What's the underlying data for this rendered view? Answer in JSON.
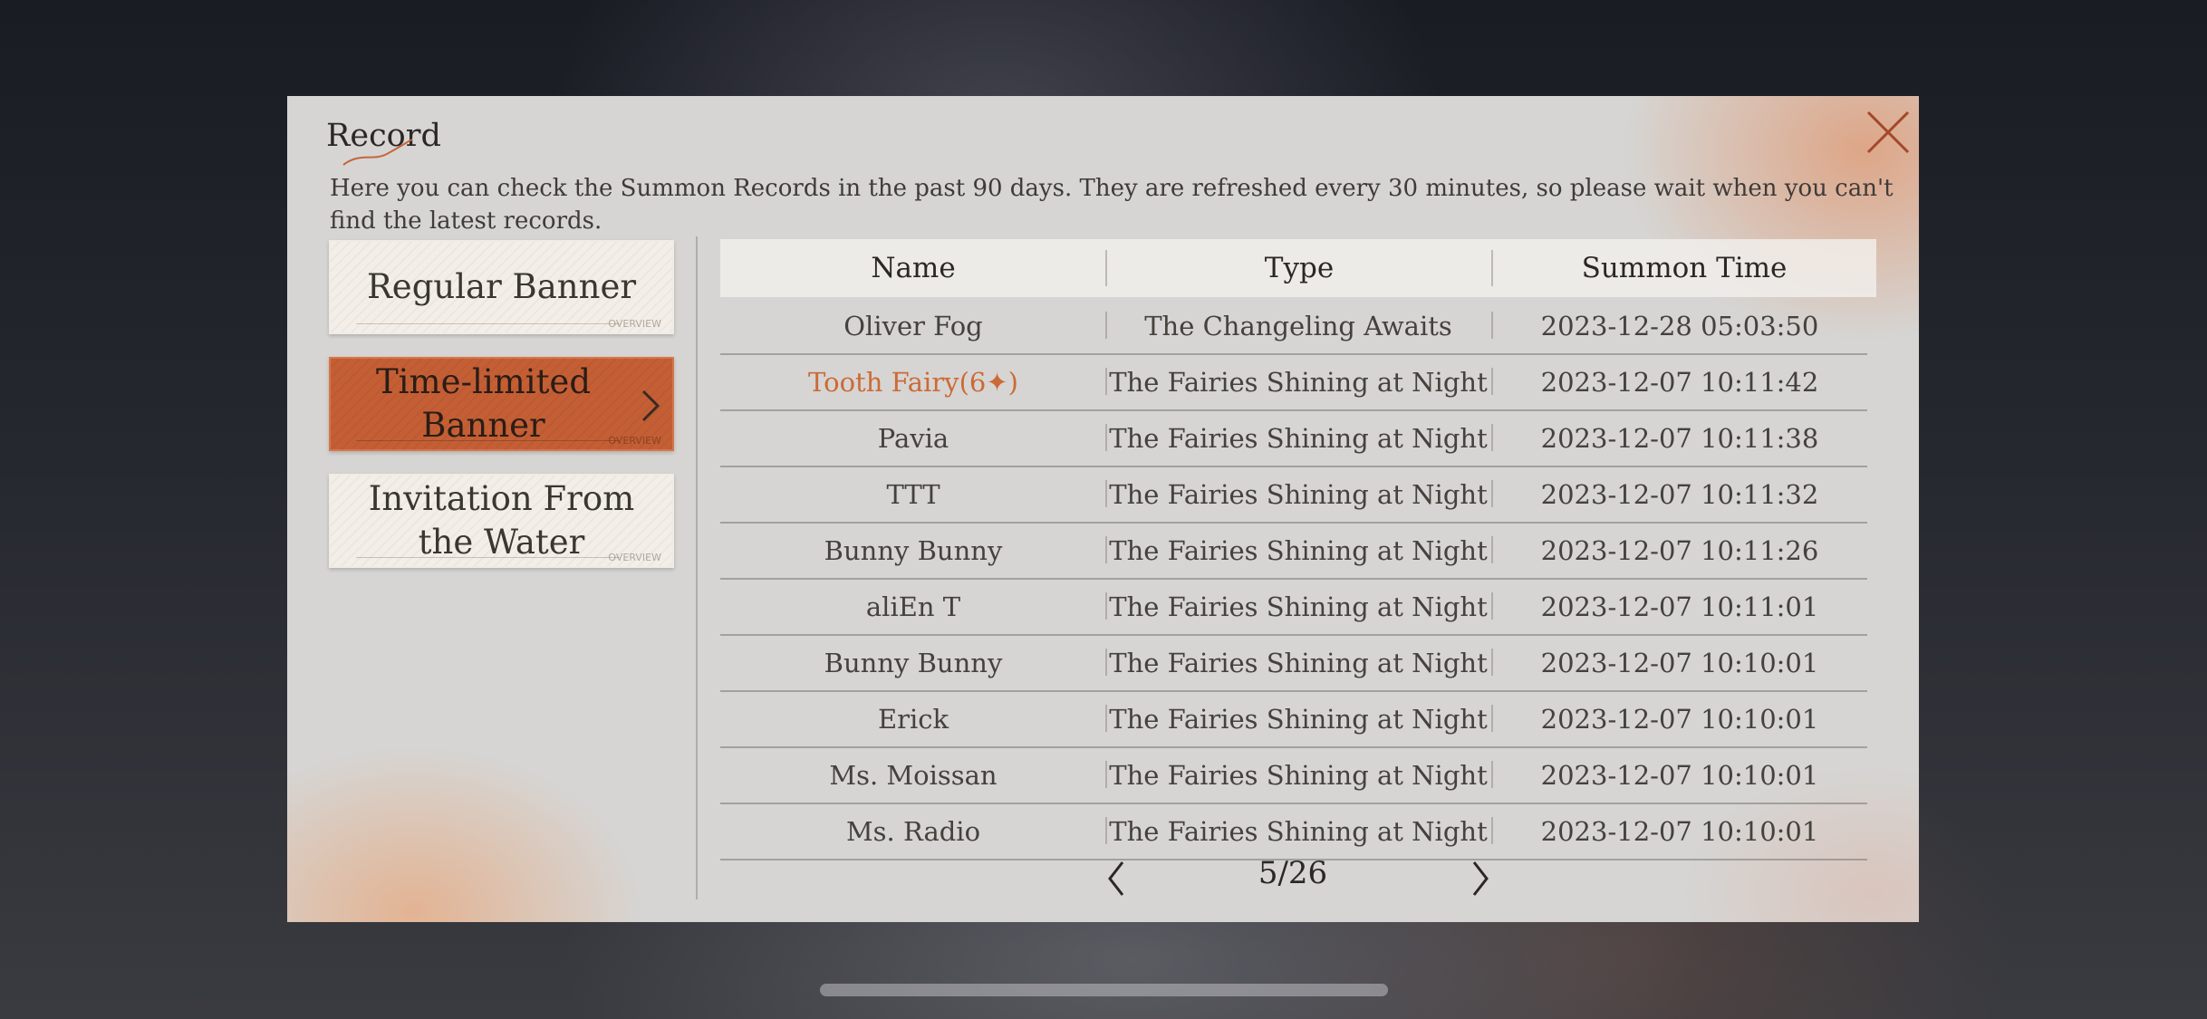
{
  "dialog": {
    "title": "Record",
    "description": "Here you can check the Summon Records in the past 90 days. They are refreshed every 30 minutes, so please wait when you can't find the latest records.",
    "accent_color": "#c45f35",
    "close_icon": "close-icon"
  },
  "banners": [
    {
      "label": "Regular Banner",
      "active": false
    },
    {
      "label": "Time-limited Banner",
      "active": true
    },
    {
      "label": "Invitation From the Water",
      "active": false
    }
  ],
  "table": {
    "headers": [
      "Name",
      "Type",
      "Summon Time"
    ],
    "rows": [
      {
        "name": "Oliver Fog",
        "type": "The Changeling Awaits",
        "time": "2023-12-28 05:03:50"
      },
      {
        "name": "Tooth Fairy(6✦)",
        "type": "The Fairies Shining at Night",
        "time": "2023-12-07 10:11:42",
        "highlight": true
      },
      {
        "name": "Pavia",
        "type": "The Fairies Shining at Night",
        "time": "2023-12-07 10:11:38"
      },
      {
        "name": "TTT",
        "type": "The Fairies Shining at Night",
        "time": "2023-12-07 10:11:32"
      },
      {
        "name": "Bunny Bunny",
        "type": "The Fairies Shining at Night",
        "time": "2023-12-07 10:11:26"
      },
      {
        "name": "aliEn T",
        "type": "The Fairies Shining at Night",
        "time": "2023-12-07 10:11:01"
      },
      {
        "name": "Bunny Bunny",
        "type": "The Fairies Shining at Night",
        "time": "2023-12-07 10:10:01"
      },
      {
        "name": "Erick",
        "type": "The Fairies Shining at Night",
        "time": "2023-12-07 10:10:01"
      },
      {
        "name": "Ms. Moissan",
        "type": "The Fairies Shining at Night",
        "time": "2023-12-07 10:10:01"
      },
      {
        "name": "Ms. Radio",
        "type": "The Fairies Shining at Night",
        "time": "2023-12-07 10:10:01"
      }
    ],
    "highlight_color": "#cc6a36"
  },
  "pagination": {
    "label": "5/26",
    "prev_icon": "chevron-left-icon",
    "next_icon": "chevron-right-icon"
  }
}
